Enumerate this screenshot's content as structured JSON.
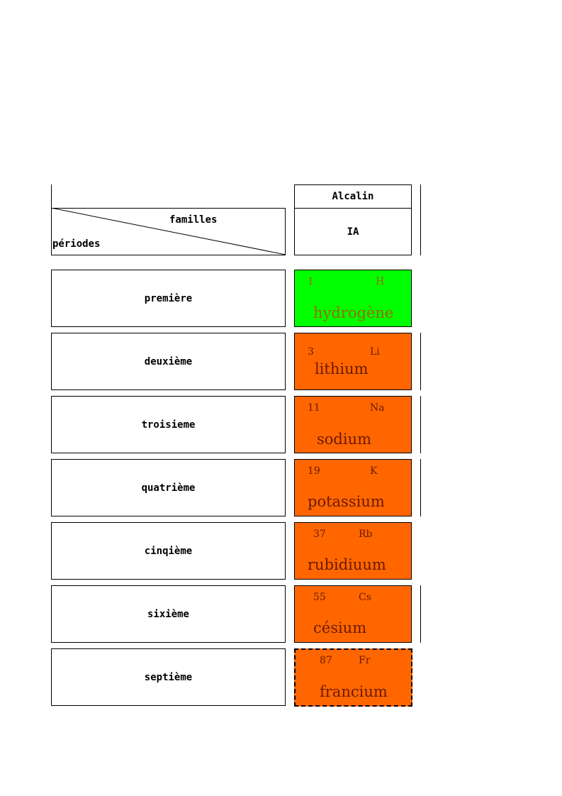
{
  "header": {
    "family_name": "Alcalin",
    "group": "IA",
    "corner_top_label": "familles",
    "corner_bottom_label": "périodes"
  },
  "colors": {
    "hydrogen_bg": "#00ff00",
    "hydrogen_text": "#9a6a00",
    "alkali_bg": "#ff6600",
    "alkali_text": "#6b1a00"
  },
  "periods": [
    {
      "label": "première"
    },
    {
      "label": "deuxième"
    },
    {
      "label": "troisieme"
    },
    {
      "label": "quatrième"
    },
    {
      "label": "cinqième"
    },
    {
      "label": "sixième"
    },
    {
      "label": "septième"
    }
  ],
  "elements": [
    {
      "number": "1",
      "symbol": "H",
      "name": "hydrogène"
    },
    {
      "number": "3",
      "symbol": "Li",
      "name": "lithium"
    },
    {
      "number": "11",
      "symbol": "Na",
      "name": "sodium"
    },
    {
      "number": "19",
      "symbol": "K",
      "name": "potassium"
    },
    {
      "number": "37",
      "symbol": "Rb",
      "name": "rubidiuum"
    },
    {
      "number": "55",
      "symbol": "Cs",
      "name": "césium"
    },
    {
      "number": "87",
      "symbol": "Fr",
      "name": "francium"
    }
  ]
}
